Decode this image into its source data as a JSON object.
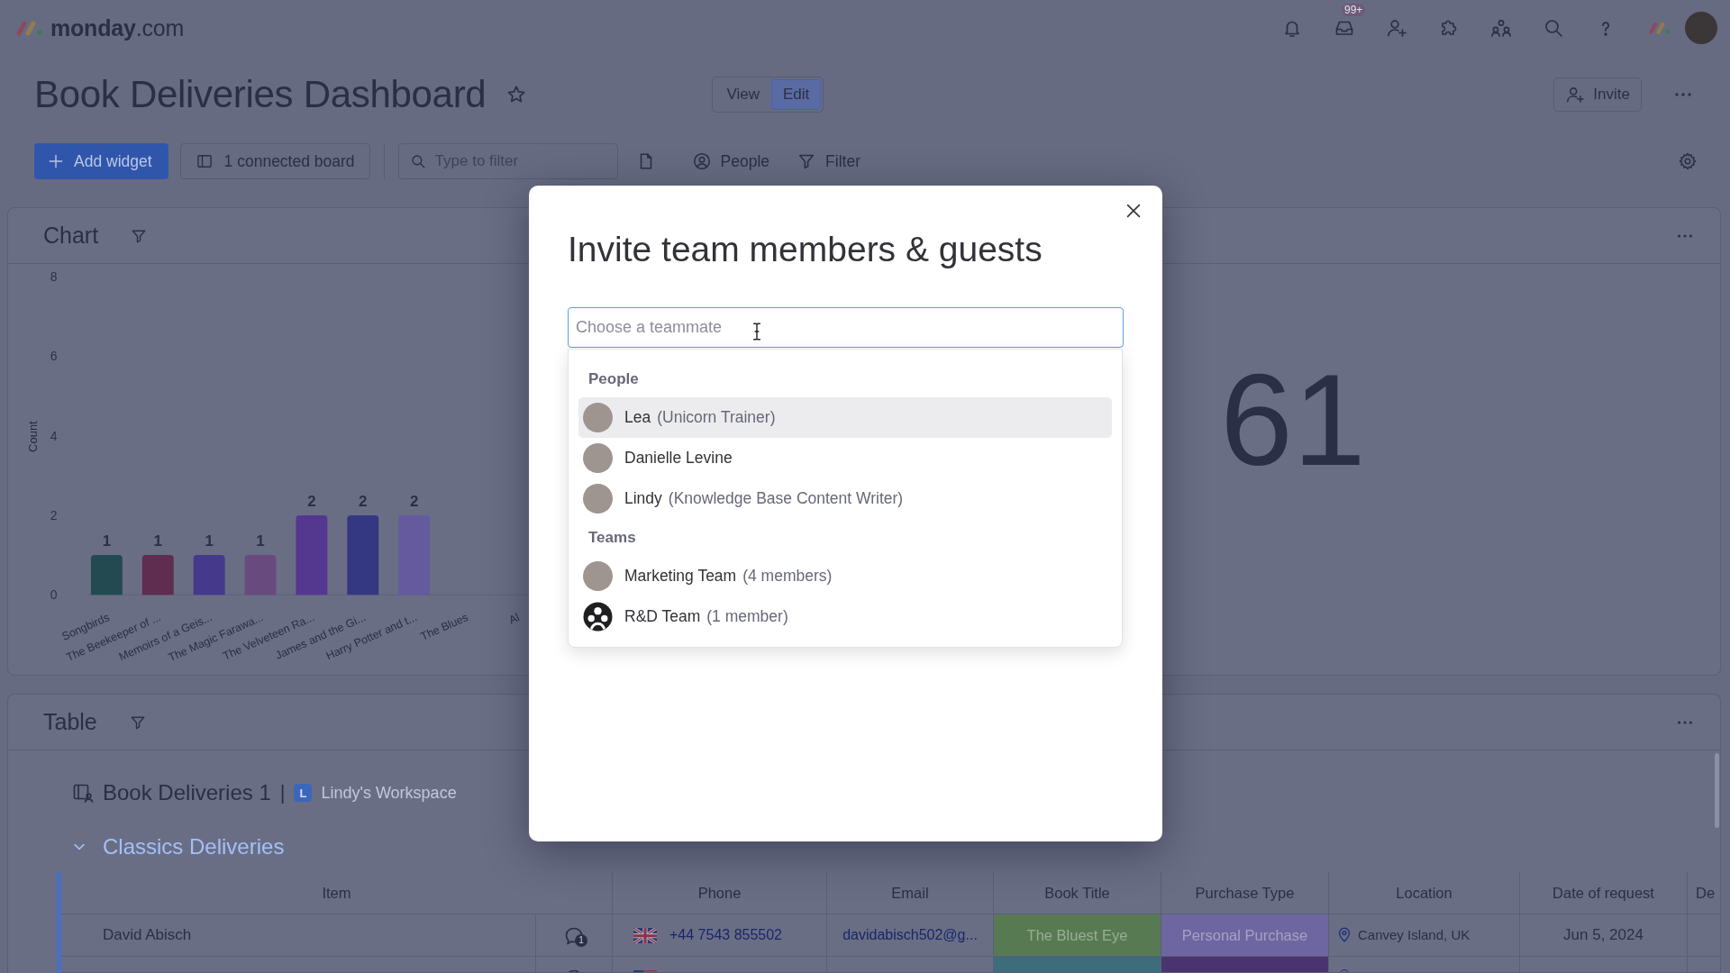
{
  "top_bar": {
    "logo": {
      "brand": "monday",
      "suffix": ".com"
    },
    "inbox_badge": "99+"
  },
  "dashboard": {
    "title": "Book Deliveries Dashboard",
    "favorite": false,
    "modes": [
      {
        "label": "View",
        "selected": false
      },
      {
        "label": "Edit",
        "selected": true
      }
    ],
    "invite": "Invite"
  },
  "toolbar": {
    "add_widget": "Add widget",
    "connected_boards": "1 connected board",
    "search": {
      "placeholder": "Type to filter"
    },
    "people": "People",
    "filter": "Filter"
  },
  "chart_widget": {
    "title": "Chart",
    "chart_data": {
      "type": "bar",
      "ylabel": "Count",
      "categories": [
        "Songbirds",
        "The Beekeeper of ...",
        "Memoirs of a Geis...",
        "The Magic Farawa...",
        "The Velveteen Ra...",
        "James and the Gi...",
        "Harry Potter and t...",
        "The Blues",
        "Al"
      ],
      "values": [
        1,
        1,
        1,
        1,
        2,
        2,
        2,
        null,
        null
      ],
      "colors": [
        "#224a50",
        "#5e2d4f",
        "#44398a",
        "#694a7e",
        "#54378f",
        "#343781",
        "#655a9e",
        null,
        null
      ],
      "ylim": [
        0,
        8
      ],
      "yticks": [
        0,
        2,
        4,
        6,
        8
      ],
      "data_labels": true
    }
  },
  "numbers_widget": {
    "value": "61"
  },
  "table_widget": {
    "title": "Table",
    "board": "Book Deliveries 1",
    "separator": "|",
    "workspace": {
      "initial": "L",
      "name": "Lindy's Workspace"
    },
    "group": {
      "title": "Classics Deliveries",
      "expanded": true
    },
    "columns": [
      "Item",
      "Phone",
      "Email",
      "Book Title",
      "Purchase Type",
      "Location",
      "Date of request",
      "De"
    ],
    "rows": [
      {
        "item": "David Abisch",
        "updates": "1",
        "phone": {
          "kind": "uk",
          "number": "+44 7543 855502"
        },
        "email": "davidabisch502@g...",
        "book_title": {
          "label": "The Bluest Eye",
          "color": "#587a52"
        },
        "purchase_type": {
          "label": "Personal Purchase",
          "color": "#6e66a0"
        },
        "location": "Canvey Island, UK",
        "date": "Jun 5, 2024"
      },
      {
        "phone": {
          "kind": "us"
        },
        "book_title": {
          "color": "#3d6d7a"
        },
        "purchase_type": {
          "color": "#4a3470"
        }
      }
    ]
  },
  "modal": {
    "title": "Invite team members & guests",
    "search": {
      "placeholder": "Choose a teammate"
    },
    "sections": [
      {
        "title": "People",
        "items": [
          {
            "name": "Lea",
            "detail": "(Unicorn Trainer)",
            "kind": "photo",
            "selected": true
          },
          {
            "name": "Danielle Levine",
            "kind": "photo",
            "selected": false
          },
          {
            "name": "Lindy",
            "detail": "(Knowledge Base Content Writer)",
            "kind": "photo",
            "selected": false
          }
        ]
      },
      {
        "title": "Teams",
        "items": [
          {
            "name": "Marketing Team",
            "detail": "(4 members)",
            "kind": "photo",
            "selected": false
          },
          {
            "name": "R&D Team",
            "detail": "(1 member)",
            "kind": "team",
            "selected": false
          }
        ]
      }
    ]
  }
}
